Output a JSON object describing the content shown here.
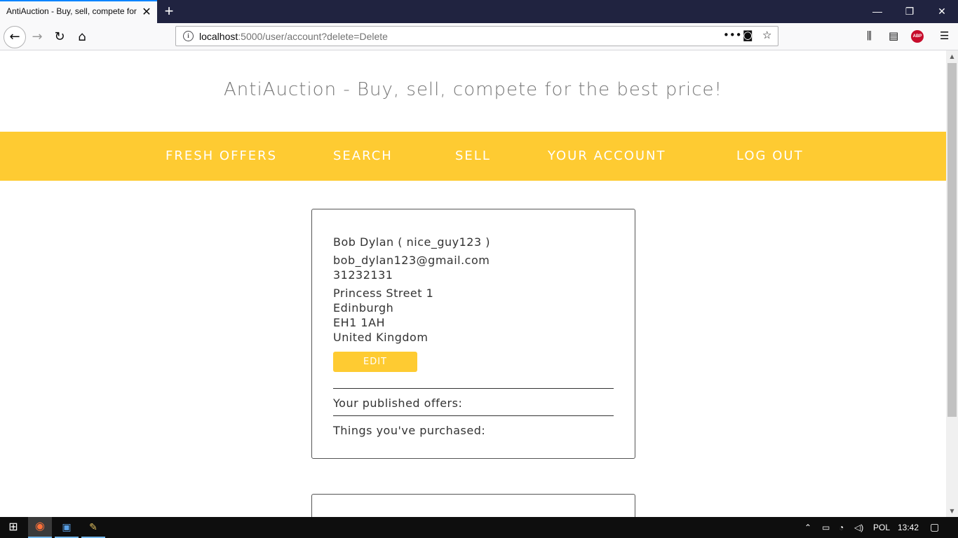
{
  "browser": {
    "tab_title": "AntiAuction - Buy, sell, compete for the best price!",
    "url_host": "localhost",
    "url_rest": ":5000/user/account?delete=Delete"
  },
  "site": {
    "title": "AntiAuction - Buy, sell, compete for the best price!",
    "menu": [
      "FRESH OFFERS",
      "SEARCH",
      "SELL",
      "YOUR ACCOUNT",
      "LOG OUT"
    ]
  },
  "account": {
    "name_line": "Bob Dylan ( nice_guy123 )",
    "email": "bob_dylan123@gmail.com",
    "phone": "31232131",
    "street": "Princess Street 1",
    "city": "Edinburgh",
    "postcode": "EH1 1AH",
    "country": "United Kingdom",
    "edit_label": "EDIT",
    "published_label": "Your published offers:",
    "purchased_label": "Things you've purchased:"
  },
  "taskbar": {
    "lang": "POL",
    "time": "13:42"
  },
  "colors": {
    "accent": "#fecb32",
    "tabbar": "#202340"
  }
}
